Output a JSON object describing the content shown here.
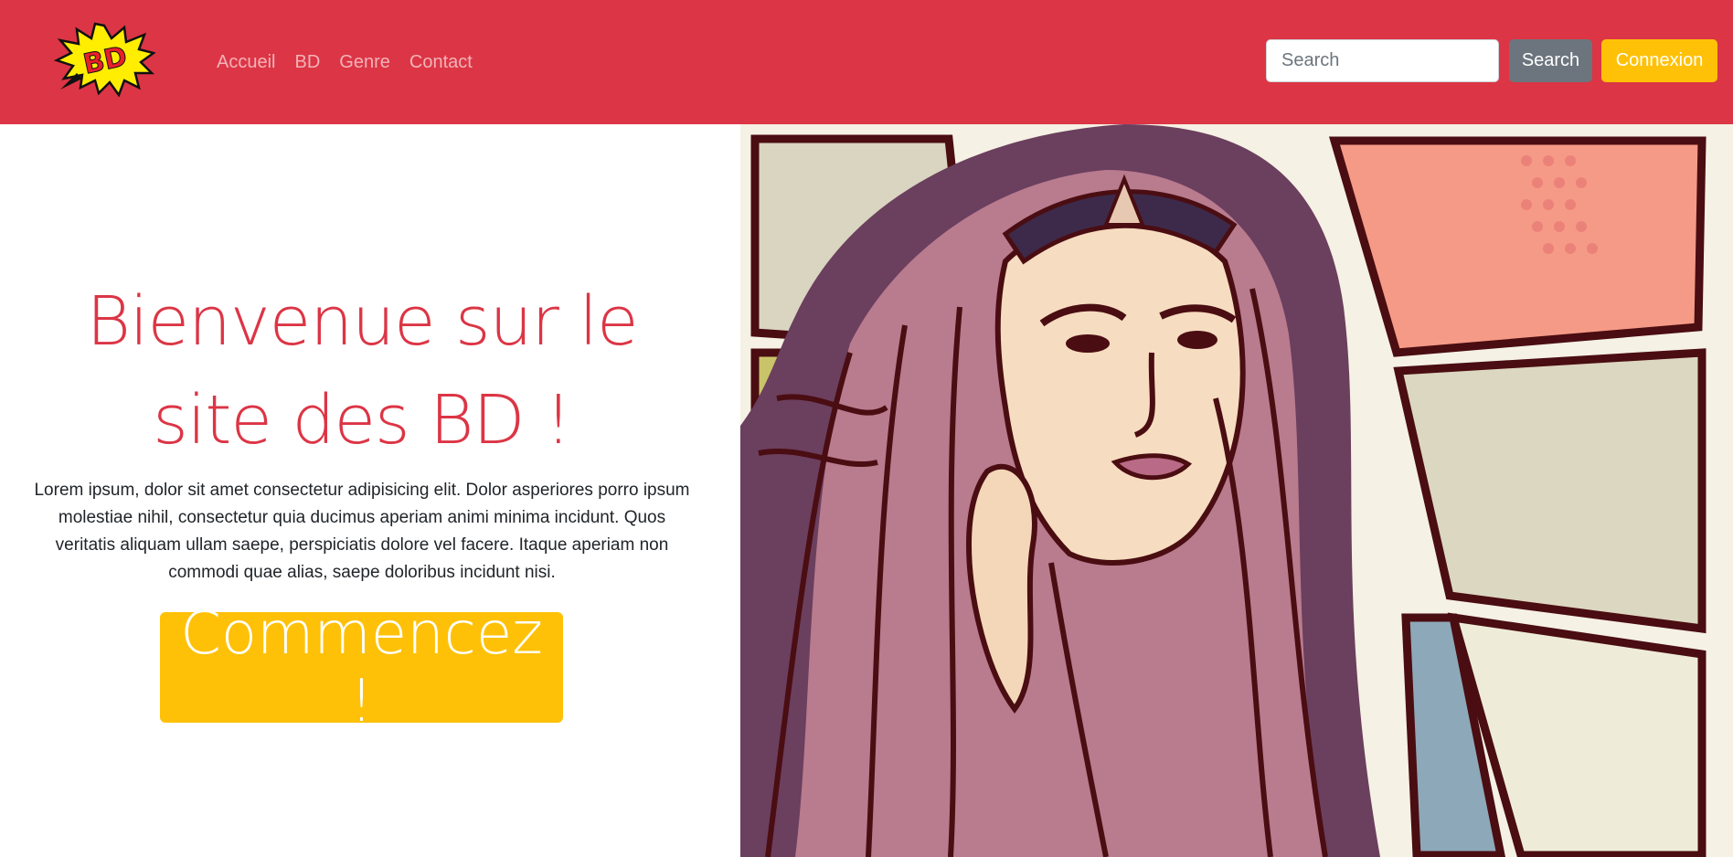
{
  "navbar": {
    "background": "#dc3545",
    "logo": {
      "text": "BD",
      "icon": "comic-burst-logo"
    },
    "links": [
      "Accueil",
      "BD",
      "Genre",
      "Contact"
    ],
    "search": {
      "placeholder": "Search",
      "value": "",
      "button_label": "Search"
    },
    "login_label": "Connexion"
  },
  "hero": {
    "title_line1": "Bienvenue sur le",
    "title_line2": "site des BD !",
    "text": "Lorem ipsum, dolor sit amet consectetur adipisicing elit. Dolor asperiores porro ipsum molestiae nihil, consectetur quia ducimus aperiam animi minima incidunt. Quos veritatis aliquam ullam saepe, perspiciatis dolore vel facere. Itaque aperiam non commodi quae alias, saepe doloribus incidunt nisi.",
    "cta_label": "Commencez !",
    "image": {
      "icon": "comic-heroine-illustration"
    }
  },
  "colors": {
    "primary": "#dc3545",
    "warning": "#ffc107",
    "secondary": "#6c757d"
  }
}
